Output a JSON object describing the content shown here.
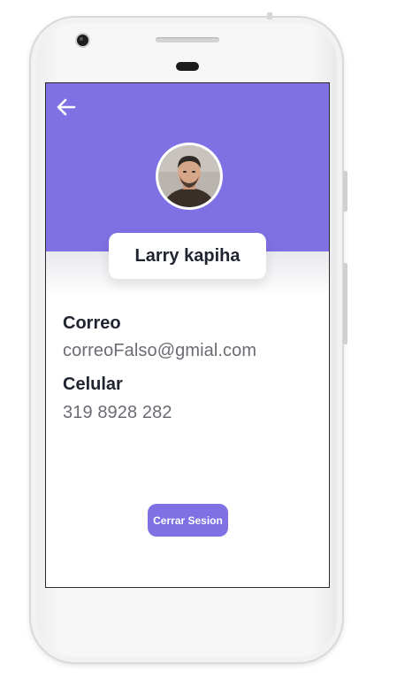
{
  "header": {
    "back_icon": "arrow-left-icon",
    "background_color": "#7f70e4"
  },
  "profile": {
    "name": "Larry kapiha",
    "avatar_icon": "profile-photo"
  },
  "fields": {
    "email_label": "Correo",
    "email_value": "correoFalso@gmial.com",
    "phone_label": "Celular",
    "phone_value": "319 8928 282"
  },
  "actions": {
    "logout_label": "Cerrar Sesion",
    "accent_color": "#7f70e4"
  }
}
